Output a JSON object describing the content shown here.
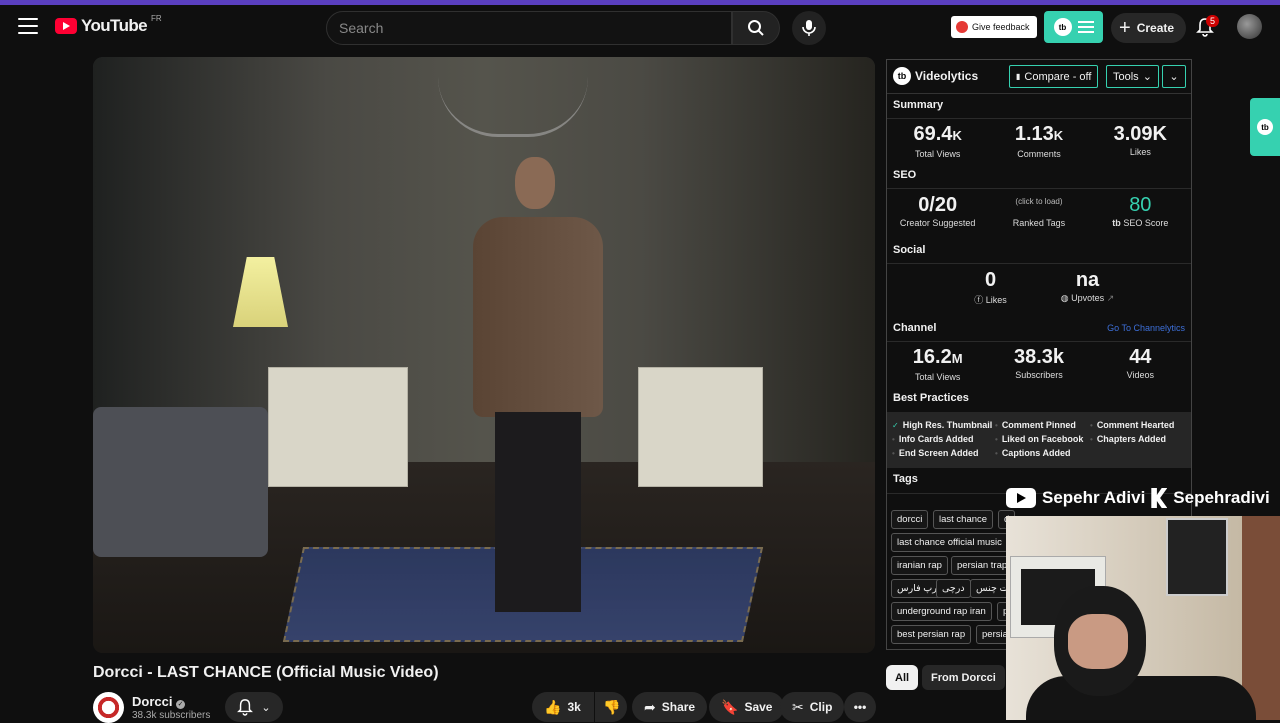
{
  "masthead": {
    "logo_text": "YouTube",
    "country_code": "FR",
    "search_placeholder": "Search",
    "feedback_label": "Give feedback",
    "create_label": "Create",
    "notification_count": "5"
  },
  "video": {
    "title": "Dorcci - LAST CHANCE (Official Music Video)",
    "channel_name": "Dorcci",
    "subscribers": "38.3k subscribers",
    "like_count": "3k",
    "share_label": "Share",
    "save_label": "Save",
    "clip_label": "Clip"
  },
  "videolytics": {
    "brand": "Videolytics",
    "compare_label": "Compare - off",
    "tools_label": "Tools",
    "summary": {
      "heading": "Summary",
      "views_value": "69.4",
      "views_unit": "K",
      "views_label": "Total Views",
      "comments_value": "1.13",
      "comments_unit": "K",
      "comments_label": "Comments",
      "likes_value": "3.09K",
      "likes_label": "Likes"
    },
    "seo": {
      "heading": "SEO",
      "creator_value": "0/20",
      "creator_label": "Creator Suggested",
      "ranked_value": "(click to load)",
      "ranked_label": "Ranked Tags",
      "score_value": "80",
      "score_label": "SEO Score"
    },
    "social": {
      "heading": "Social",
      "likes_value": "0",
      "likes_label": "Likes",
      "upvotes_value": "na",
      "upvotes_label": "Upvotes"
    },
    "channel": {
      "heading": "Channel",
      "link_label": "Go To Channelytics",
      "views_value": "16.2",
      "views_unit": "M",
      "views_label": "Total Views",
      "subs_value": "38.3k",
      "subs_label": "Subscribers",
      "videos_value": "44",
      "videos_label": "Videos"
    },
    "best_practices": {
      "heading": "Best Practices",
      "items": [
        {
          "label": "High Res. Thumbnail",
          "ok": true
        },
        {
          "label": "Comment Pinned",
          "ok": false
        },
        {
          "label": "Comment Hearted",
          "ok": false
        },
        {
          "label": "Info Cards Added",
          "ok": false
        },
        {
          "label": "Liked on Facebook",
          "ok": false
        },
        {
          "label": "Chapters Added",
          "ok": false
        },
        {
          "label": "End Screen Added",
          "ok": false
        },
        {
          "label": "Captions Added",
          "ok": false
        }
      ]
    },
    "tags": {
      "heading": "Tags",
      "items": [
        "dorcci",
        "last chance",
        "d",
        "last chance official music",
        "iranian rap",
        "persian trap",
        "رپ فارس",
        "درچی",
        "ست چنس",
        "underground rap iran",
        "p",
        "best persian rap",
        "persia"
      ]
    }
  },
  "overlay": {
    "youtube_name": "Sepehr Adivi",
    "kick_name": "Sepehradivi"
  },
  "chips": {
    "all": "All",
    "from_channel": "From Dorcci"
  },
  "colors": {
    "accent": "#36d1b0",
    "youtube_red": "#ff0033",
    "seo_score": "#36d1b0",
    "link": "#3d6fd8"
  }
}
